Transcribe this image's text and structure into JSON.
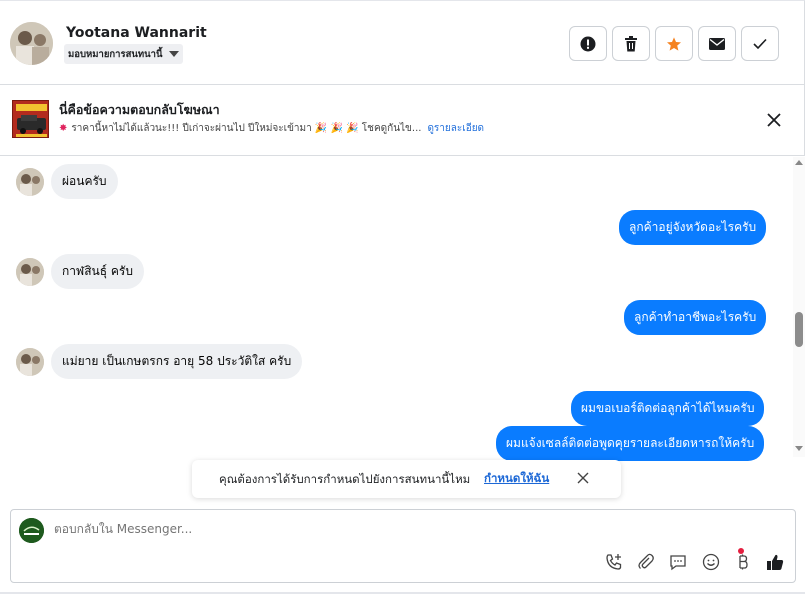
{
  "header": {
    "name": "Yootana Wannarit",
    "assign_label": "มอบหมายการสนทนานี้",
    "buttons": [
      "spam-icon",
      "trash-icon",
      "star-icon",
      "envelope-icon",
      "check-icon"
    ]
  },
  "ad": {
    "title": "นี่คือข้อความตอบกลับโฆษณา",
    "subtitle": "ราคานี้หาไม่ได้แล้วนะ!!! ปีเก่าจะผ่านไป ปีใหม่จะเข้ามา 🎉 🎉 🎉 โชคดูกันไข...",
    "link": "ดูรายละเอียด"
  },
  "messages": [
    {
      "side": "in",
      "text": "ผ่อนครับ"
    },
    {
      "side": "out",
      "text": "ลูกค้าอยู่จังหวัดอะไรครับ"
    },
    {
      "side": "in",
      "text": "กาฬสินธุ์ ครับ"
    },
    {
      "side": "out",
      "text": "ลูกค้าทำอาชีพอะไรครับ"
    },
    {
      "side": "in",
      "text": "แม่ยาย เป็นเกษตรกร อายุ 58 ประวัติใส ครับ"
    },
    {
      "side": "out",
      "text": "ผมขอเบอร์ติดต่อลูกค้าได้ไหมครับ"
    },
    {
      "side": "out",
      "text": "ผมแจ้งเซลล์ติดต่อพูดคุยรายละเอียดหารถให้ครับ"
    }
  ],
  "toast": {
    "text": "คุณต้องการได้รับการกำหนดไปยังการสนทนานี้ไหม",
    "link": "กำหนดให้ฉัน"
  },
  "composer": {
    "placeholder": "ตอบกลับใน Messenger..."
  },
  "colors": {
    "outgoing_bubble": "#0a7cff",
    "incoming_bubble": "#eef0f3",
    "star": "#f5821f",
    "link": "#216fdb"
  }
}
